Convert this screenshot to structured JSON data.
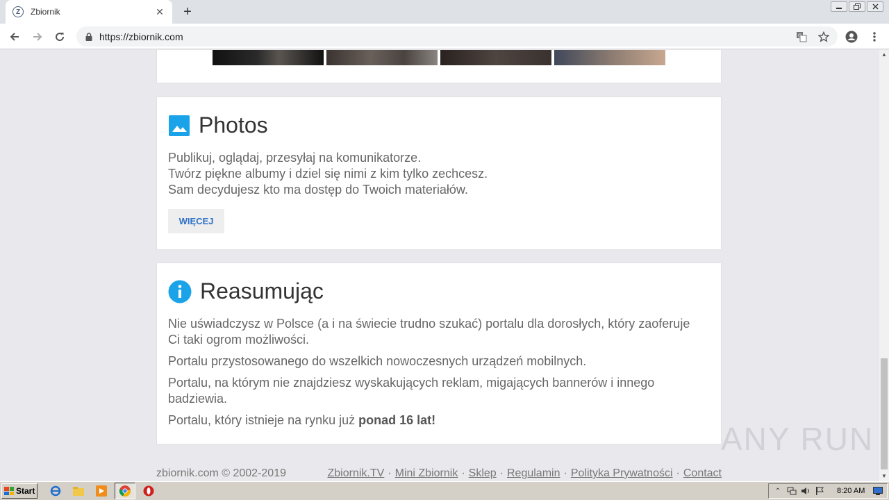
{
  "browser": {
    "tab_title": "Zbiornik",
    "tab_favicon_letter": "Z",
    "tab_close": "✕",
    "new_tab": "+",
    "url": "https://zbiornik.com",
    "window_controls": [
      "minimize",
      "restore",
      "close"
    ]
  },
  "photos": {
    "title": "Photos",
    "icon": "image-icon",
    "lines": [
      "Publikuj, oglądaj, przesyłaj na komunikatorze.",
      "Twórz piękne albumy i dziel się nimi z kim tylko zechcesz.",
      "Sam decydujesz kto ma dostęp do Twoich materiałów."
    ],
    "button_label": "WIĘCEJ",
    "accent_color": "#1aa3e8"
  },
  "summary": {
    "title": "Reasumując",
    "icon": "info-icon",
    "paragraphs": [
      "Nie uświadczysz w Polsce (a i na świecie trudno szukać) portalu dla dorosłych, który zaoferuje Ci taki ogrom możliwości.",
      "Portalu przystosowanego do wszelkich nowoczesnych urządzeń mobilnych.",
      "Portalu, na którym nie znajdziesz wyskakujących reklam, migających bannerów i innego badziewia."
    ],
    "last_prefix": "Portalu, który istnieje na rynku już ",
    "last_bold": "ponad 16 lat!"
  },
  "footer": {
    "copyright": "zbiornik.com © 2002-2019",
    "links": [
      "Zbiornik.TV",
      "Mini Zbiornik",
      "Sklep",
      "Regulamin",
      "Polityka Prywatności",
      "Contact"
    ],
    "separator": "·"
  },
  "watermark": "ANY RUN",
  "taskbar": {
    "start_label": "Start",
    "clock": "8:20 AM"
  }
}
